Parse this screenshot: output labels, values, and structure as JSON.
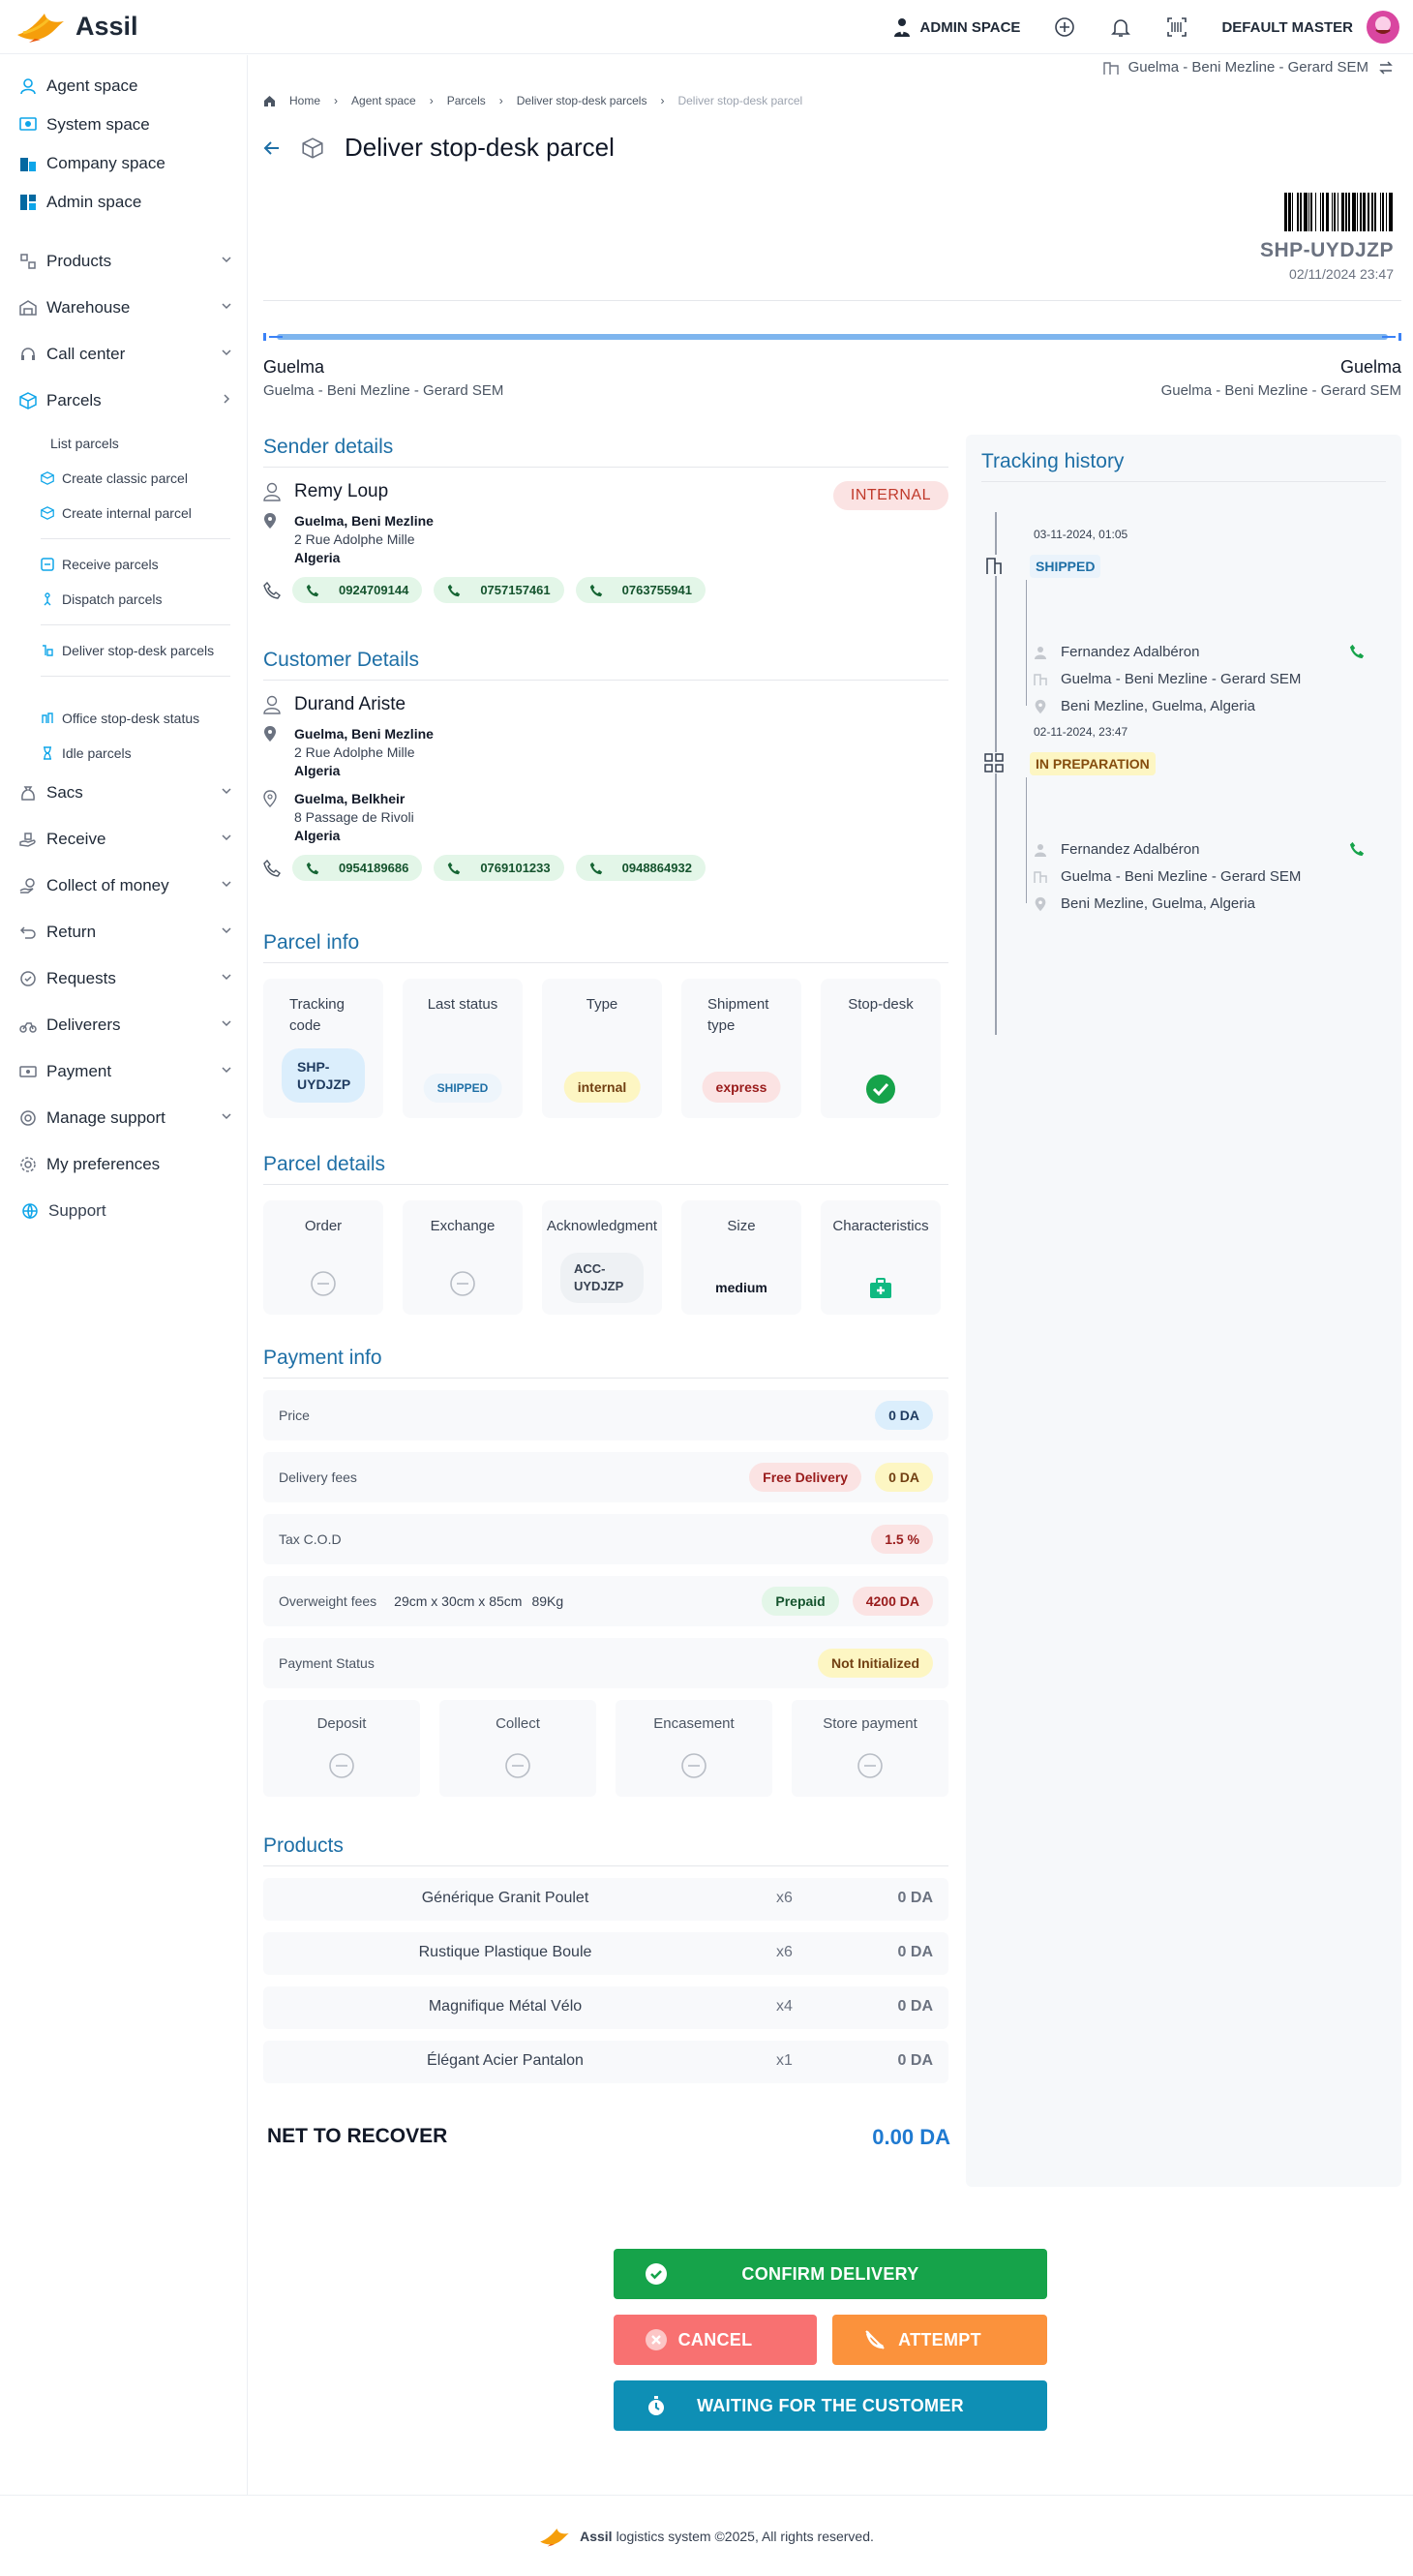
{
  "app": {
    "name": "Assil"
  },
  "topbar": {
    "admin_space": "ADMIN SPACE",
    "user_name": "DEFAULT MASTER"
  },
  "sidebar": {
    "spaces": [
      "Agent space",
      "System space",
      "Company space",
      "Admin space"
    ],
    "menus": [
      "Products",
      "Warehouse",
      "Call center",
      "Parcels"
    ],
    "parcels_sub": [
      "List parcels",
      "Create classic parcel",
      "Create internal parcel",
      "Receive parcels",
      "Dispatch parcels",
      "Deliver stop-desk parcels",
      "Office stop-desk status",
      "Idle parcels"
    ],
    "menus2": [
      "Sacs",
      "Receive",
      "Collect of money",
      "Return",
      "Requests",
      "Deliverers",
      "Payment",
      "Manage support",
      "My preferences",
      "Support"
    ]
  },
  "context": {
    "office": "Guelma - Beni Mezline - Gerard SEM"
  },
  "breadcrumb": [
    "Home",
    "Agent space",
    "Parcels",
    "Deliver stop-desk parcels",
    "Deliver stop-desk parcel"
  ],
  "page_title": "Deliver stop-desk parcel",
  "parcel": {
    "tracking": "SHP-UYDJZP",
    "date": "02/11/2024 23:47"
  },
  "route": {
    "from_city": "Guelma",
    "from_office": "Guelma - Beni Mezline - Gerard SEM",
    "to_city": "Guelma",
    "to_office": "Guelma - Beni Mezline - Gerard SEM"
  },
  "sender": {
    "title": "Sender details",
    "name": "Remy Loup",
    "badge": "INTERNAL",
    "addr_city": "Guelma, Beni Mezline",
    "addr_street": "2 Rue Adolphe Mille",
    "addr_country": "Algeria",
    "phones": [
      "0924709144",
      "0757157461",
      "0763755941"
    ]
  },
  "customer": {
    "title": "Customer Details",
    "name": "Durand Ariste",
    "addr1_city": "Guelma, Beni Mezline",
    "addr1_street": "2 Rue Adolphe Mille",
    "addr1_country": "Algeria",
    "addr2_city": "Guelma, Belkheir",
    "addr2_street": "8 Passage de Rivoli",
    "addr2_country": "Algeria",
    "phones": [
      "0954189686",
      "0769101233",
      "0948864932"
    ]
  },
  "parcel_info": {
    "title": "Parcel info",
    "labels": [
      "Tracking code",
      "Last status",
      "Type",
      "Shipment type",
      "Stop-desk"
    ],
    "tracking_code": "SHP-UYDJZP",
    "last_status": "SHIPPED",
    "type": "internal",
    "shipment_type": "express"
  },
  "parcel_details": {
    "title": "Parcel details",
    "labels": [
      "Order",
      "Exchange",
      "Acknowledgment",
      "Size",
      "Characteristics"
    ],
    "acknowledgment": "ACC-UYDJZP",
    "size": "medium"
  },
  "payment": {
    "title": "Payment info",
    "price_label": "Price",
    "price": "0 DA",
    "delivery_label": "Delivery fees",
    "free_delivery": "Free Delivery",
    "delivery": "0 DA",
    "tax_label": "Tax C.O.D",
    "tax": "1.5 %",
    "overweight_label": "Overweight fees",
    "dimensions": "29cm x 30cm x 85cm",
    "weight": "89Kg",
    "prepaid": "Prepaid",
    "overweight": "4200 DA",
    "status_label": "Payment Status",
    "status": "Not Initialized",
    "cards": [
      "Deposit",
      "Collect",
      "Encasement",
      "Store payment"
    ]
  },
  "products": {
    "title": "Products",
    "items": [
      {
        "name": "Générique Granit Poulet",
        "qty": "x6",
        "price": "0 DA"
      },
      {
        "name": "Rustique Plastique Boule",
        "qty": "x6",
        "price": "0 DA"
      },
      {
        "name": "Magnifique Métal Vélo",
        "qty": "x4",
        "price": "0 DA"
      },
      {
        "name": "Élégant Acier Pantalon",
        "qty": "x1",
        "price": "0 DA"
      }
    ]
  },
  "net": {
    "label": "NET TO RECOVER",
    "value": "0.00 DA"
  },
  "tracking_history": {
    "title": "Tracking history",
    "events": [
      {
        "date": "03-11-2024, 01:05",
        "status": "SHIPPED",
        "agent": "Fernandez Adalbéron",
        "office": "Guelma - Beni Mezline - Gerard SEM",
        "location": "Beni Mezline, Guelma, Algeria"
      },
      {
        "date": "02-11-2024, 23:47",
        "status": "IN PREPARATION",
        "agent": "Fernandez Adalbéron",
        "office": "Guelma - Beni Mezline - Gerard SEM",
        "location": "Beni Mezline, Guelma, Algeria"
      }
    ]
  },
  "actions": {
    "confirm": "CONFIRM DELIVERY",
    "cancel": "CANCEL",
    "attempt": "ATTEMPT",
    "waiting": "WAITING FOR THE CUSTOMER"
  },
  "footer": {
    "brand": "Assil",
    "text": "logistics system ©2025, All rights reserved."
  },
  "colors": {
    "accent": "#1e6fa6",
    "green": "#16a34a",
    "red": "#f87171",
    "orange": "#fb923c",
    "teal": "#0e8fb5"
  }
}
